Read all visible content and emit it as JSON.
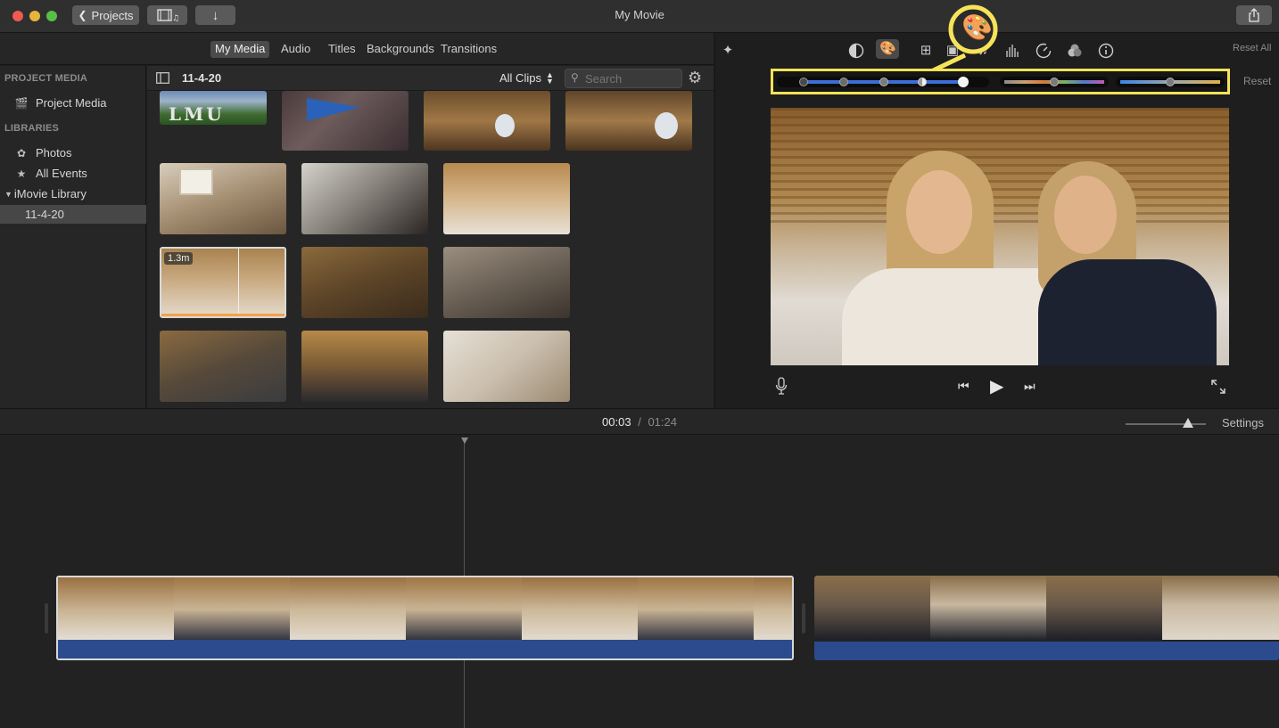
{
  "window": {
    "title": "My Movie",
    "projects_button": "Projects"
  },
  "browser": {
    "tabs": [
      "My Media",
      "Audio",
      "Titles",
      "Backgrounds",
      "Transitions"
    ],
    "active_tab": "My Media",
    "event_title": "11-4-20",
    "filter_label": "All Clips",
    "search_placeholder": "Search",
    "clip_badge": "1.3m"
  },
  "sidebar": {
    "project_media_header": "PROJECT MEDIA",
    "project_media_item": "Project Media",
    "libraries_header": "LIBRARIES",
    "items": [
      "Photos",
      "All Events",
      "iMovie Library",
      "11-4-20"
    ]
  },
  "viewer": {
    "reset_all": "Reset All",
    "reset": "Reset"
  },
  "timeline": {
    "current_time": "00:03",
    "separator": "/",
    "total_time": "01:24",
    "settings_label": "Settings"
  },
  "colors": {
    "highlight": "#f7e35a",
    "audio": "#2b4b8e",
    "selected_border": "#f3c560"
  },
  "icons": [
    "magic-wand-icon",
    "color-balance-icon",
    "color-correction-icon",
    "crop-icon",
    "stabilization-icon",
    "volume-icon",
    "noise-eq-icon",
    "speed-icon",
    "clip-filter-icon",
    "info-icon",
    "microphone-icon",
    "skip-back-icon",
    "play-icon",
    "skip-forward-icon",
    "fullscreen-icon",
    "share-icon",
    "import-icon",
    "media-toggle-icon",
    "gear-icon",
    "search-icon"
  ]
}
